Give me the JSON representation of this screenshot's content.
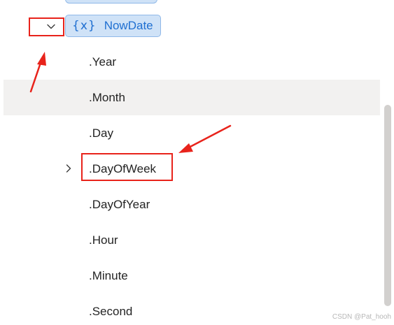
{
  "variable": {
    "icon_glyph": "{x}",
    "name": "NowDate"
  },
  "properties": [
    {
      "label": ".Year",
      "hovered": false,
      "expandable": false
    },
    {
      "label": ".Month",
      "hovered": true,
      "expandable": false
    },
    {
      "label": ".Day",
      "hovered": false,
      "expandable": false
    },
    {
      "label": ".DayOfWeek",
      "hovered": false,
      "expandable": true
    },
    {
      "label": ".DayOfYear",
      "hovered": false,
      "expandable": false
    },
    {
      "label": ".Hour",
      "hovered": false,
      "expandable": false
    },
    {
      "label": ".Minute",
      "hovered": false,
      "expandable": false
    },
    {
      "label": ".Second",
      "hovered": false,
      "expandable": false
    }
  ],
  "watermark": "CSDN @Pat_hooh",
  "colors": {
    "accent": "#1f6fd1",
    "pill_background": "#cfe2f7",
    "hover_background": "#f2f1f0",
    "annotation_red": "#e8231b"
  },
  "icons": {
    "collapse": "chevron-down-icon",
    "expand": "chevron-right-icon"
  }
}
